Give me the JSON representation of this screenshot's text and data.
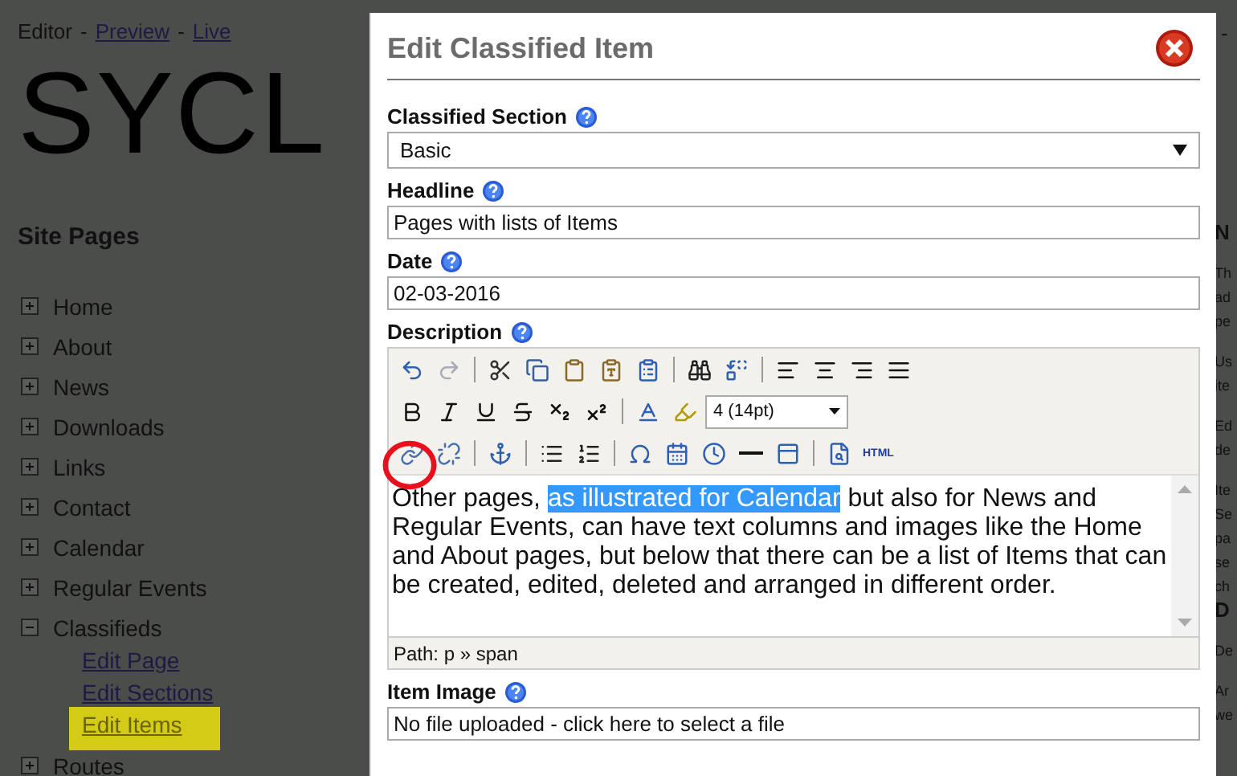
{
  "header": {
    "editor": "Editor",
    "separator_1": "-",
    "preview_link": "Preview",
    "separator_2": "-",
    "live_link": "Live",
    "right_cut_text": "-"
  },
  "logo": "SYCL",
  "sidebar": {
    "title": "Site Pages",
    "items": [
      {
        "label": "Home",
        "expanded": false
      },
      {
        "label": "About",
        "expanded": false
      },
      {
        "label": "News",
        "expanded": false
      },
      {
        "label": "Downloads",
        "expanded": false
      },
      {
        "label": "Links",
        "expanded": false
      },
      {
        "label": "Contact",
        "expanded": false
      },
      {
        "label": "Calendar",
        "expanded": false
      },
      {
        "label": "Regular Events",
        "expanded": false
      },
      {
        "label": "Classifieds",
        "expanded": true,
        "children": [
          {
            "label": "Edit Page",
            "highlighted": false
          },
          {
            "label": "Edit Sections",
            "highlighted": false
          },
          {
            "label": "Edit Items",
            "highlighted": true
          }
        ]
      },
      {
        "label": "Routes",
        "expanded": false
      }
    ]
  },
  "right_column": [
    {
      "lines": [
        {
          "text": "N",
          "bold": true
        }
      ]
    },
    {
      "lines": [
        {
          "text": "Th",
          "bold": false
        },
        {
          "text": "ad",
          "bold": false
        },
        {
          "text": "pe",
          "bold": false
        }
      ]
    },
    {
      "lines": [
        {
          "text": "Us",
          "bold": false
        },
        {
          "text": "ite",
          "bold": false
        }
      ]
    },
    {
      "lines": [
        {
          "text": "Ed",
          "bold": false
        },
        {
          "text": "de",
          "bold": false
        }
      ]
    },
    {
      "lines": [
        {
          "text": "Ite",
          "bold": false
        },
        {
          "text": "Se",
          "bold": false
        },
        {
          "text": "pa",
          "bold": false
        },
        {
          "text": "se",
          "bold": false
        },
        {
          "text": "ch",
          "bold": false
        },
        {
          "text": "D",
          "bold": true
        }
      ]
    },
    {
      "lines": [
        {
          "text": "De",
          "bold": false
        }
      ]
    },
    {
      "lines": [
        {
          "text": "Ar",
          "bold": false
        },
        {
          "text": "we",
          "bold": false
        }
      ]
    }
  ],
  "dialog": {
    "title": "Edit Classified Item",
    "fields": [
      {
        "kind": "select",
        "label": "Classified Section",
        "value": "Basic"
      },
      {
        "kind": "text",
        "label": "Headline",
        "value": "Pages with lists of Items"
      },
      {
        "kind": "text",
        "label": "Date",
        "value": "02-03-2016"
      },
      {
        "kind": "editor",
        "label": "Description",
        "font_size": "4 (14pt)",
        "html_button": "HTML",
        "path": "Path: p » span",
        "content": [
          {
            "text": "Other pages, ",
            "selected": false
          },
          {
            "text": "as illustrated for Calendar",
            "selected": true
          },
          {
            "text": " but also for News and Regular Events, can have text columns and images like the Home and About pages, but below that there can be a list of Items that can be created, edited, deleted and arranged in different order.",
            "selected": false
          }
        ]
      },
      {
        "kind": "text",
        "label": "Item Image",
        "value": "No file uploaded - click here to select a file"
      }
    ]
  }
}
